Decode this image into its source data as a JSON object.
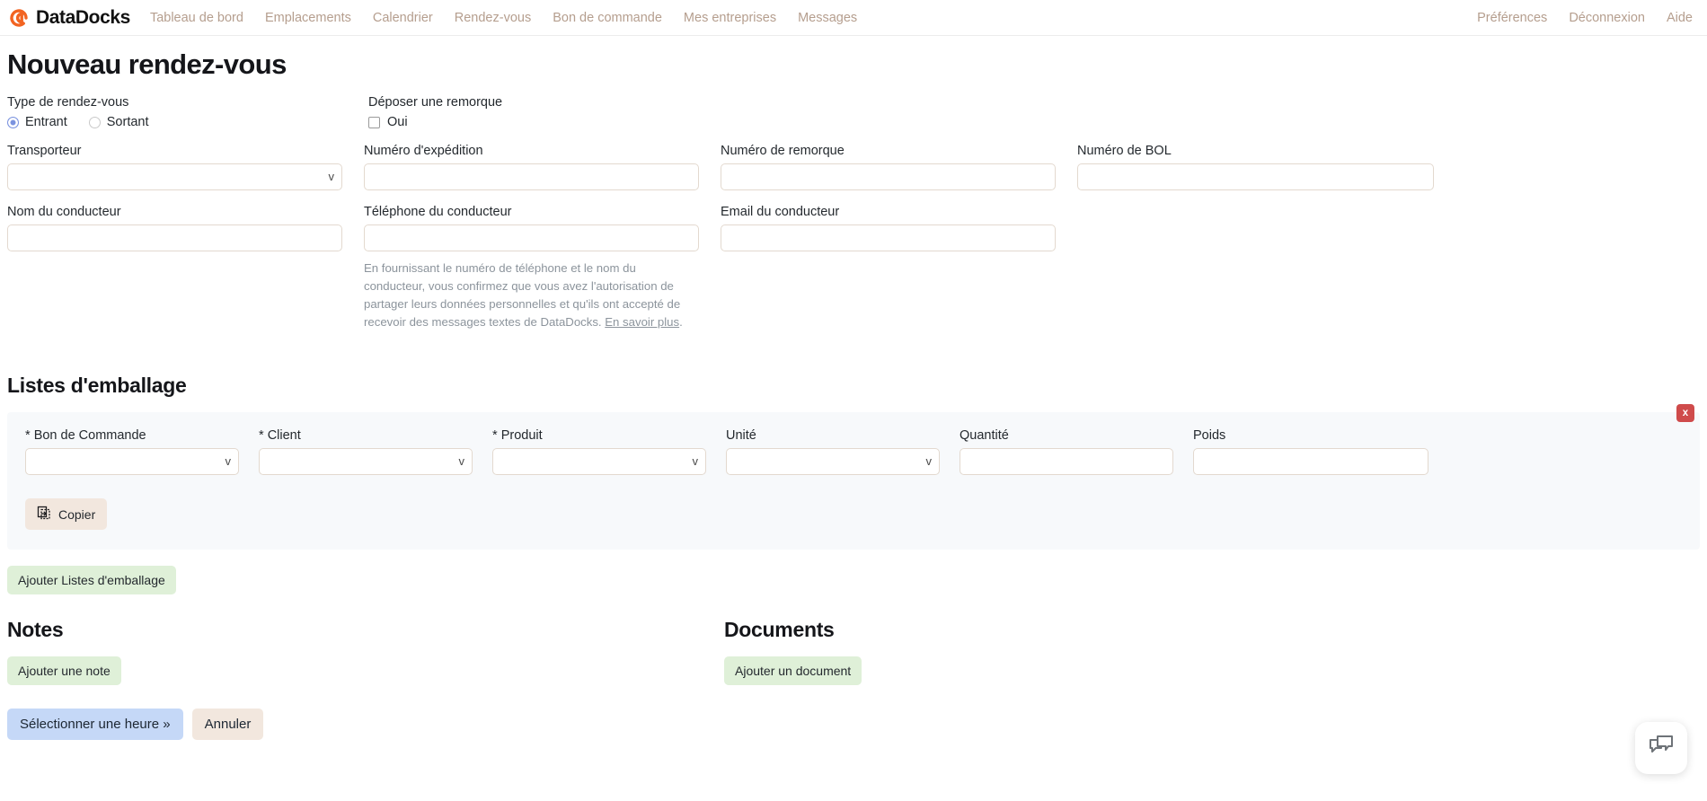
{
  "nav": {
    "brand": "DataDocks",
    "brand_color": "#f26422",
    "links": [
      {
        "label": "Tableau de bord"
      },
      {
        "label": "Emplacements"
      },
      {
        "label": "Calendrier"
      },
      {
        "label": "Rendez-vous"
      },
      {
        "label": "Bon de commande"
      },
      {
        "label": "Mes entreprises"
      },
      {
        "label": "Messages"
      }
    ],
    "right_links": [
      {
        "label": "Préférences"
      },
      {
        "label": "Déconnexion"
      },
      {
        "label": "Aide"
      }
    ]
  },
  "page": {
    "title": "Nouveau rendez-vous"
  },
  "appointment_type": {
    "label": "Type de rendez-vous",
    "options": [
      {
        "label": "Entrant",
        "selected": true
      },
      {
        "label": "Sortant",
        "selected": false
      }
    ]
  },
  "drop_trailer": {
    "label": "Déposer une remorque",
    "checkbox_label": "Oui",
    "checked": false
  },
  "fields_row1": [
    {
      "label": "Transporteur",
      "value": "",
      "type": "select"
    },
    {
      "label": "Numéro d'expédition",
      "value": "",
      "type": "text"
    },
    {
      "label": "Numéro de remorque",
      "value": "",
      "type": "text"
    },
    {
      "label": "Numéro de BOL",
      "value": "",
      "type": "text"
    }
  ],
  "fields_row2": [
    {
      "label": "Nom du conducteur",
      "value": "",
      "type": "text"
    },
    {
      "label": "Téléphone du conducteur",
      "value": "",
      "type": "text"
    },
    {
      "label": "Email du conducteur",
      "value": "",
      "type": "text"
    }
  ],
  "consent": {
    "text": "En fournissant le numéro de téléphone et le nom du conducteur, vous confirmez que vous avez l'autorisation de partager leurs données personnelles et qu'ils ont accepté de recevoir des messages textes de DataDocks. ",
    "link_label": "En savoir plus",
    "suffix": "."
  },
  "packing_lists": {
    "section_title": "Listes d'emballage",
    "delete_label": "x",
    "copy_label": "Copier",
    "copy_icon": "copy-icon",
    "add_label": "Ajouter Listes d'emballage",
    "columns": [
      {
        "label": "Bon de Commande",
        "required": true,
        "type": "select",
        "value": ""
      },
      {
        "label": "Client",
        "required": true,
        "type": "select",
        "value": ""
      },
      {
        "label": "Produit",
        "required": true,
        "type": "select",
        "value": ""
      },
      {
        "label": "Unité",
        "required": false,
        "type": "select",
        "value": ""
      },
      {
        "label": "Quantité",
        "required": false,
        "type": "text",
        "value": ""
      },
      {
        "label": "Poids",
        "required": false,
        "type": "text",
        "value": ""
      }
    ]
  },
  "notes": {
    "title": "Notes",
    "add_label": "Ajouter une note"
  },
  "documents": {
    "title": "Documents",
    "add_label": "Ajouter un document"
  },
  "actions": {
    "primary_label": "Sélectionner une heure »",
    "secondary_label": "Annuler"
  },
  "chat": {
    "icon": "chat-bubbles-icon"
  }
}
